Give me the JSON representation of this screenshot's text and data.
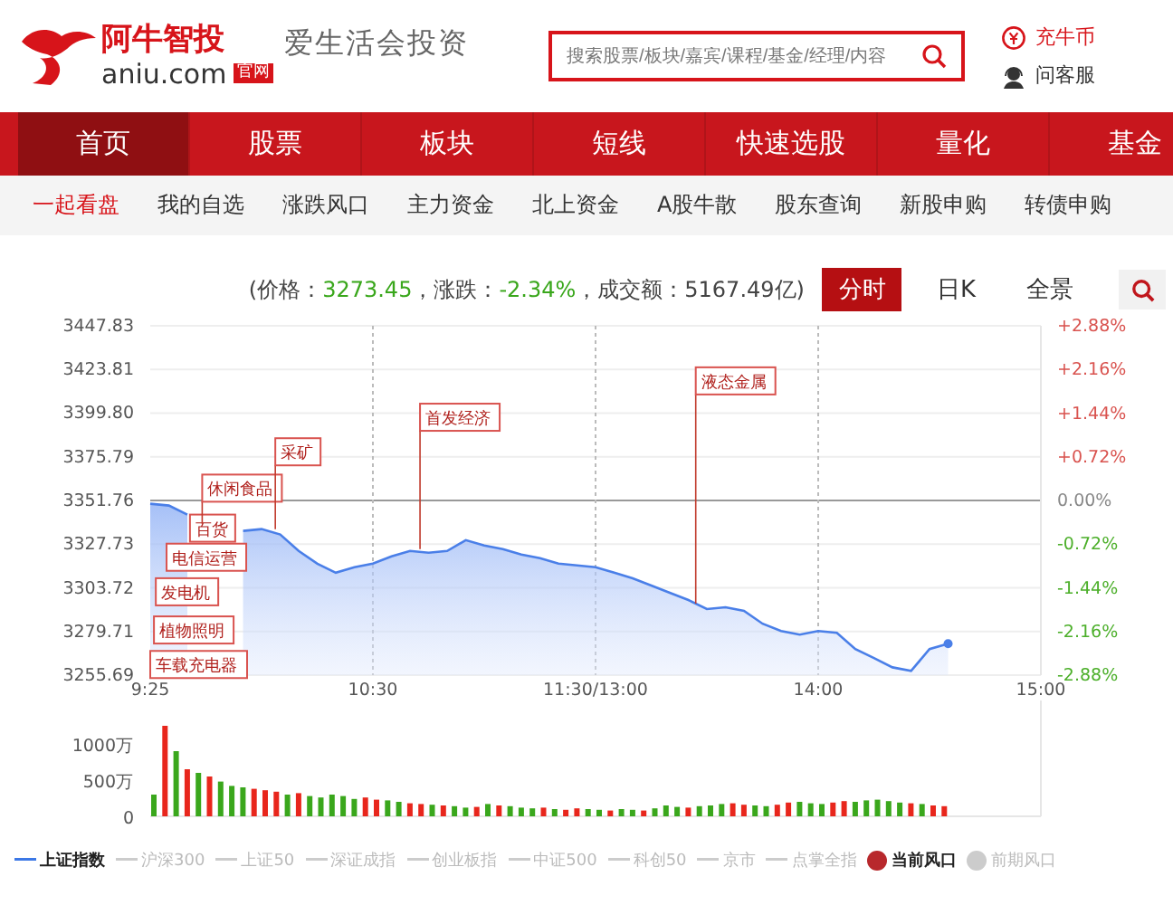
{
  "header": {
    "brand": "阿牛智投",
    "domain": "aniu.com",
    "badge": "官网",
    "slogan": "爱生活会投资",
    "search": {
      "placeholder": "搜索股票/板块/嘉宾/课程/基金/经理/内容"
    },
    "links": [
      {
        "label": "充牛币",
        "kind": "coin"
      },
      {
        "label": "问客服",
        "kind": "service"
      }
    ]
  },
  "nav": [
    {
      "label": "首页",
      "selected": true
    },
    {
      "label": "股票",
      "selected": false
    },
    {
      "label": "板块",
      "selected": false
    },
    {
      "label": "短线",
      "selected": false
    },
    {
      "label": "快速选股",
      "selected": false
    },
    {
      "label": "量化",
      "selected": false
    },
    {
      "label": "基金",
      "selected": false
    }
  ],
  "subnav": [
    {
      "label": "一起看盘",
      "selected": true
    },
    {
      "label": "我的自选",
      "selected": false
    },
    {
      "label": "涨跌风口",
      "selected": false
    },
    {
      "label": "主力资金",
      "selected": false
    },
    {
      "label": "北上资金",
      "selected": false
    },
    {
      "label": "A股牛散",
      "selected": false
    },
    {
      "label": "股东查询",
      "selected": false
    },
    {
      "label": "新股申购",
      "selected": false
    },
    {
      "label": "转债申购",
      "selected": false
    }
  ],
  "stats": [
    {
      "text": "(价格：",
      "kind": "label"
    },
    {
      "text": "3273.45",
      "kind": "down"
    },
    {
      "text": "，涨跌：",
      "kind": "label"
    },
    {
      "text": "-2.34%",
      "kind": "down"
    },
    {
      "text": "，成交额：",
      "kind": "label"
    },
    {
      "text": "5167.49亿)",
      "kind": "label"
    }
  ],
  "view_tabs": [
    {
      "label": "分时",
      "selected": true
    },
    {
      "label": "日K",
      "selected": false
    },
    {
      "label": "全景",
      "selected": false
    }
  ],
  "price_chart": {
    "chart_data": {
      "type": "area",
      "ylim": [
        3255.69,
        3447.83
      ],
      "y2lim": [
        -2.88,
        2.88
      ],
      "categories": [
        "9:25",
        null,
        null,
        null,
        null,
        null,
        null,
        null,
        null,
        null,
        null,
        null,
        "10:30",
        null,
        null,
        null,
        null,
        null,
        null,
        null,
        null,
        null,
        null,
        null,
        "11:30/13:00",
        null,
        null,
        null,
        null,
        null,
        null,
        null,
        null,
        null,
        null,
        null,
        "14:00",
        null,
        null,
        null,
        null,
        null,
        null,
        null,
        null,
        null,
        null,
        null,
        "15:00"
      ],
      "yticks": [
        {
          "value": 3447.83,
          "label": "3447.83"
        },
        {
          "value": 3423.81,
          "label": "3423.81"
        },
        {
          "value": 3399.8,
          "label": "3399.80"
        },
        {
          "value": 3375.79,
          "label": "3375.79"
        },
        {
          "value": 3351.76,
          "label": "3351.76"
        },
        {
          "value": 3327.73,
          "label": "3327.73"
        },
        {
          "value": 3303.72,
          "label": "3303.72"
        },
        {
          "value": 3279.71,
          "label": "3279.71"
        },
        {
          "value": 3255.69,
          "label": "3255.69"
        }
      ],
      "y2ticks": [
        {
          "value": 2.88,
          "label": "+2.88%"
        },
        {
          "value": 2.16,
          "label": "+2.16%"
        },
        {
          "value": 1.44,
          "label": "+1.44%"
        },
        {
          "value": 0.72,
          "label": "+0.72%"
        },
        {
          "value": 0,
          "label": "0.00%"
        },
        {
          "value": -0.72,
          "label": "-0.72%"
        },
        {
          "value": -1.44,
          "label": "-1.44%"
        },
        {
          "value": -2.16,
          "label": "-2.16%"
        },
        {
          "value": -2.88,
          "label": "-2.88%"
        }
      ],
      "grid": true,
      "series": [
        {
          "color": "#4a7fe8",
          "values": [
            3350,
            3349,
            3344,
            null,
            null,
            3335,
            3336,
            3333,
            3324,
            3317,
            3312,
            3315,
            3317,
            3321,
            3324,
            3323,
            3324,
            3330,
            3327,
            3325,
            3322,
            3320,
            3317,
            3316,
            3315,
            3312,
            3309,
            3305,
            3301,
            3297,
            3292,
            3293,
            3291,
            3284,
            3280,
            3278,
            3280,
            3279,
            3270,
            3265,
            3260,
            3258,
            3270,
            3273,
            null,
            null,
            null,
            null,
            null
          ]
        }
      ],
      "annotations": [
        "车载充电器",
        "植物照明",
        "发电机",
        "电信运营",
        "百货",
        "休闲食品",
        "采矿",
        "首发经济",
        "液态金属"
      ]
    }
  },
  "volume_chart": {
    "chart_data": {
      "type": "bar",
      "stacked": true,
      "ylim": [
        0,
        1300
      ],
      "yticks": [
        {
          "value": 0,
          "label": "0"
        },
        {
          "value": 500,
          "label": "500万"
        },
        {
          "value": 1000,
          "label": "1000万"
        }
      ],
      "series": [
        {
          "color": "#e8261c",
          "values": [
            null,
            1250,
            null,
            650,
            null,
            550,
            null,
            null,
            null,
            380,
            360,
            340,
            null,
            320,
            null,
            null,
            null,
            null,
            null,
            260,
            230,
            null,
            null,
            180,
            170,
            null,
            150,
            null,
            null,
            130,
            null,
            150,
            null,
            null,
            null,
            120,
            null,
            90,
            110,
            null,
            null,
            80,
            null,
            null,
            80,
            null,
            null,
            null,
            120,
            null,
            null,
            null,
            180,
            160,
            null,
            null,
            160,
            190,
            null,
            null,
            null,
            190,
            210,
            null,
            null,
            null,
            null,
            null,
            180,
            null,
            150,
            140
          ]
        },
        {
          "color": "#3aa71c",
          "values": [
            300,
            null,
            900,
            null,
            600,
            null,
            480,
            420,
            400,
            null,
            null,
            null,
            300,
            null,
            280,
            260,
            300,
            280,
            240,
            null,
            null,
            220,
            200,
            null,
            null,
            160,
            null,
            140,
            120,
            null,
            170,
            null,
            140,
            120,
            110,
            null,
            100,
            null,
            null,
            100,
            90,
            null,
            100,
            90,
            null,
            110,
            150,
            130,
            null,
            140,
            150,
            170,
            null,
            null,
            150,
            140,
            null,
            null,
            200,
            180,
            170,
            null,
            null,
            200,
            220,
            230,
            210,
            190,
            null,
            170,
            null,
            null
          ]
        }
      ]
    }
  },
  "legend": [
    {
      "label": "上证指数",
      "kind": "line",
      "selected": true
    },
    {
      "label": "沪深300",
      "kind": "line",
      "selected": false
    },
    {
      "label": "上证50",
      "kind": "line",
      "selected": false
    },
    {
      "label": "深证成指",
      "kind": "line",
      "selected": false
    },
    {
      "label": "创业板指",
      "kind": "line",
      "selected": false
    },
    {
      "label": "中证500",
      "kind": "line",
      "selected": false
    },
    {
      "label": "科创50",
      "kind": "line",
      "selected": false
    },
    {
      "label": "京市",
      "kind": "line",
      "selected": false
    },
    {
      "label": "点掌全指",
      "kind": "line",
      "selected": false
    },
    {
      "label": "当前风口",
      "kind": "dot",
      "selected": true
    },
    {
      "label": "前期风口",
      "kind": "dot",
      "selected": false
    }
  ]
}
